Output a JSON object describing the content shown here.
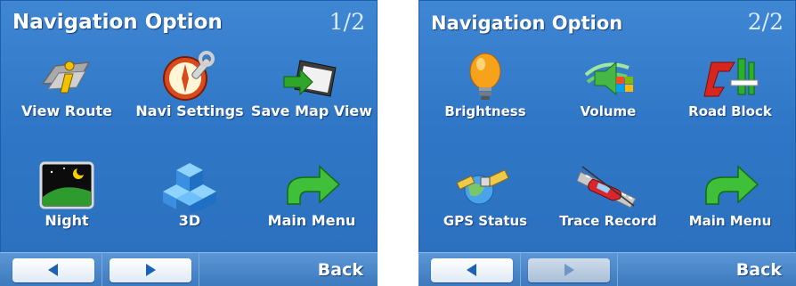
{
  "screens": [
    {
      "title": "Navigation Option",
      "page": "1/2",
      "items": [
        {
          "label": "View Route",
          "icon": "info-route-icon"
        },
        {
          "label": "Navi Settings",
          "icon": "compass-wrench-icon"
        },
        {
          "label": "Save Map View",
          "icon": "save-map-icon"
        },
        {
          "label": "Night",
          "icon": "night-moon-icon"
        },
        {
          "label": "3D",
          "icon": "3d-cubes-icon"
        },
        {
          "label": "Main Menu",
          "icon": "green-arrow-icon"
        }
      ],
      "back_label": "Back"
    },
    {
      "title": "Navigation Option",
      "page": "2/2",
      "items": [
        {
          "label": "Brightness",
          "icon": "lightbulb-icon"
        },
        {
          "label": "Volume",
          "icon": "speaker-icon"
        },
        {
          "label": "Road Block",
          "icon": "road-block-icon"
        },
        {
          "label": "GPS Status",
          "icon": "satellite-icon"
        },
        {
          "label": "Trace Record",
          "icon": "car-trace-icon"
        },
        {
          "label": "Main Menu",
          "icon": "green-arrow-icon"
        }
      ],
      "back_label": "Back"
    }
  ],
  "colors": {
    "background": "#2f77c6",
    "title_text": "#ffffff",
    "page_text": "#d9ecff"
  }
}
